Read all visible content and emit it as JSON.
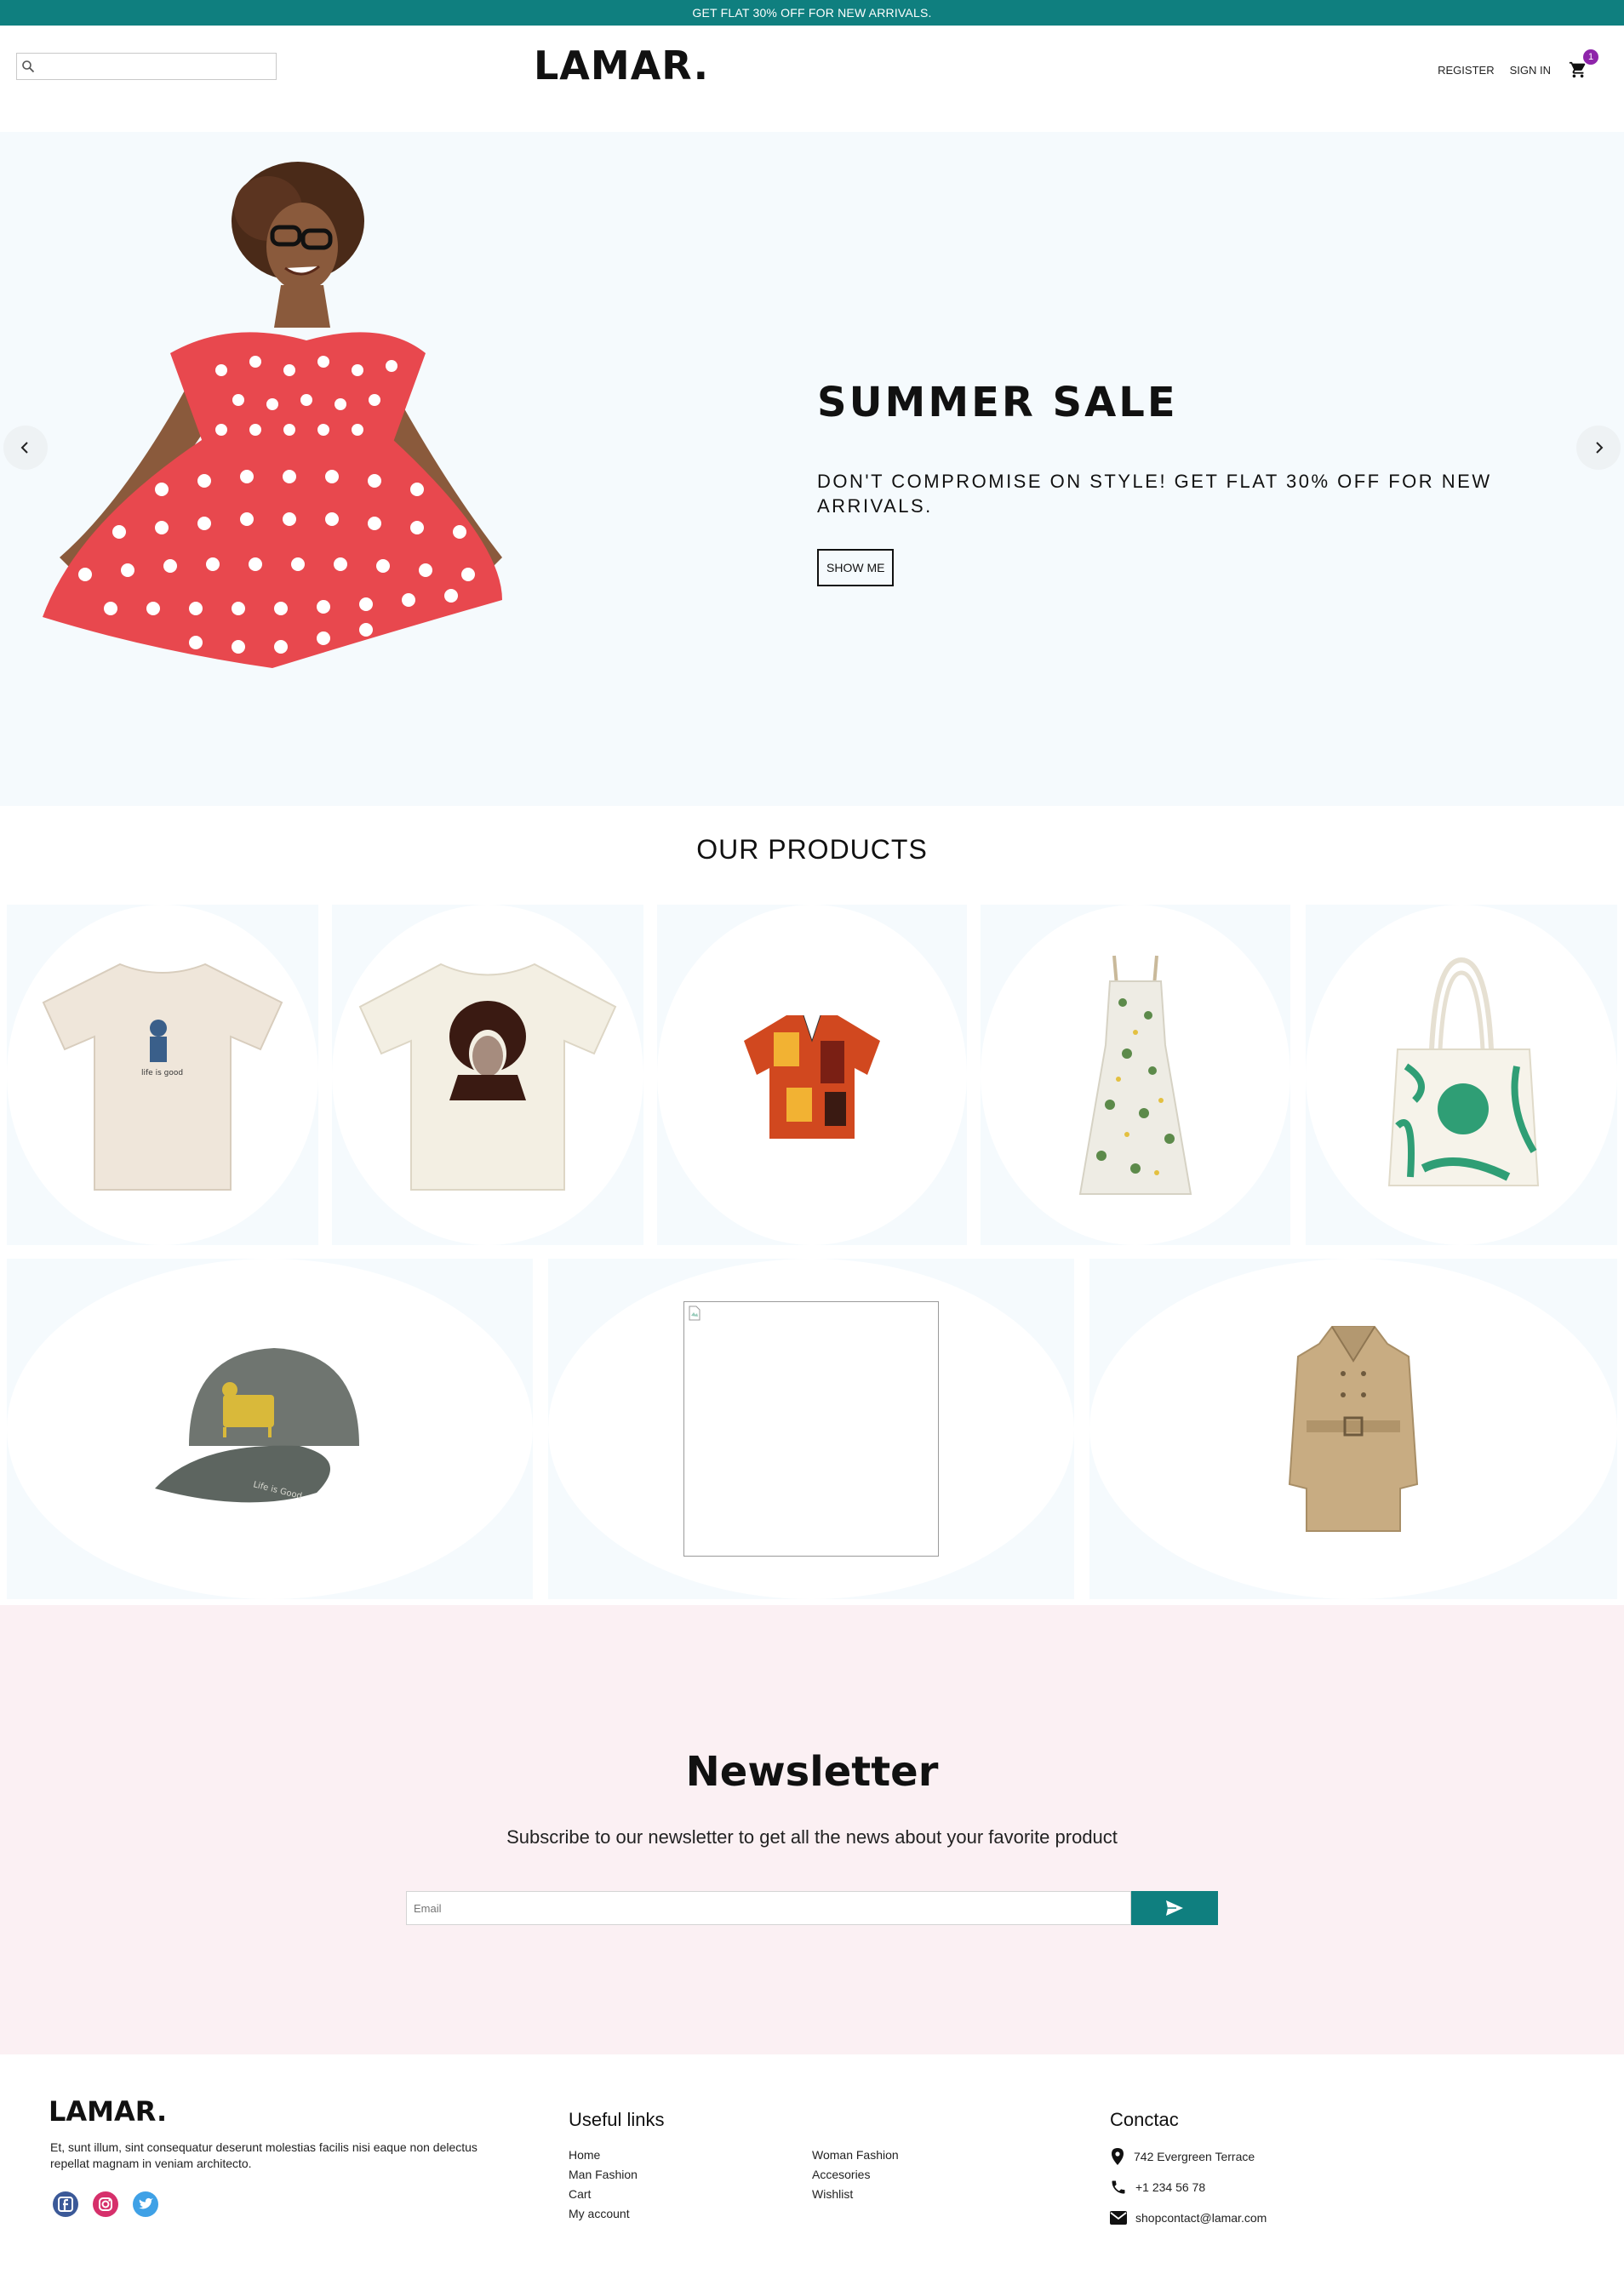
{
  "announcement": "GET FLAT 30% OFF FOR NEW ARRIVALS.",
  "header": {
    "logo": "LAMAR.",
    "search_placeholder": "",
    "register": "REGISTER",
    "sign_in": "SIGN IN",
    "cart_count": "1",
    "cart_icon": "shopping-cart-icon",
    "search_icon": "search-icon"
  },
  "hero": {
    "title": "SUMMER SALE",
    "subtitle": "DON'T COMPROMISE ON STYLE! GET FLAT 30% OFF FOR NEW ARRIVALS.",
    "button": "SHOW ME",
    "prev_icon": "chevron-left-icon",
    "next_icon": "chevron-right-icon"
  },
  "products": {
    "title": "OUR PRODUCTS",
    "items": [
      {
        "name": "beige graphic t-shirt"
      },
      {
        "name": "white portrait t-shirt"
      },
      {
        "name": "printed short-sleeve shirt"
      },
      {
        "name": "floral strap dress"
      },
      {
        "name": "green print tote bag"
      },
      {
        "name": "grey cap"
      },
      {
        "name": "broken image"
      },
      {
        "name": "beige trench coat"
      }
    ]
  },
  "newsletter": {
    "title": "Newsletter",
    "subtitle": "Subscribe to our newsletter to get all the news about your favorite product",
    "email_placeholder": "Email",
    "send_icon": "send-icon"
  },
  "footer": {
    "logo": "LAMAR.",
    "description": "Et, sunt illum, sint consequatur deserunt molestias facilis nisi eaque non delectus repellat magnam in veniam architecto.",
    "socials": [
      "facebook-icon",
      "instagram-icon",
      "twitter-icon"
    ],
    "useful_links_title": "Useful links",
    "links_col1": [
      "Home",
      "Man Fashion",
      "Cart",
      "My account"
    ],
    "links_col2": [
      "Woman Fashion",
      "Accesories",
      "Wishlist"
    ],
    "contact_title": "Conctac",
    "address": "742 Evergreen Terrace",
    "phone": "+1 234 56 78",
    "email": "shopcontact@lamar.com"
  },
  "colors": {
    "accent": "#0f7f7f",
    "badge": "#8e24aa",
    "hero_bg": "#f5fafd",
    "newsletter_bg": "#fbf0f3"
  }
}
